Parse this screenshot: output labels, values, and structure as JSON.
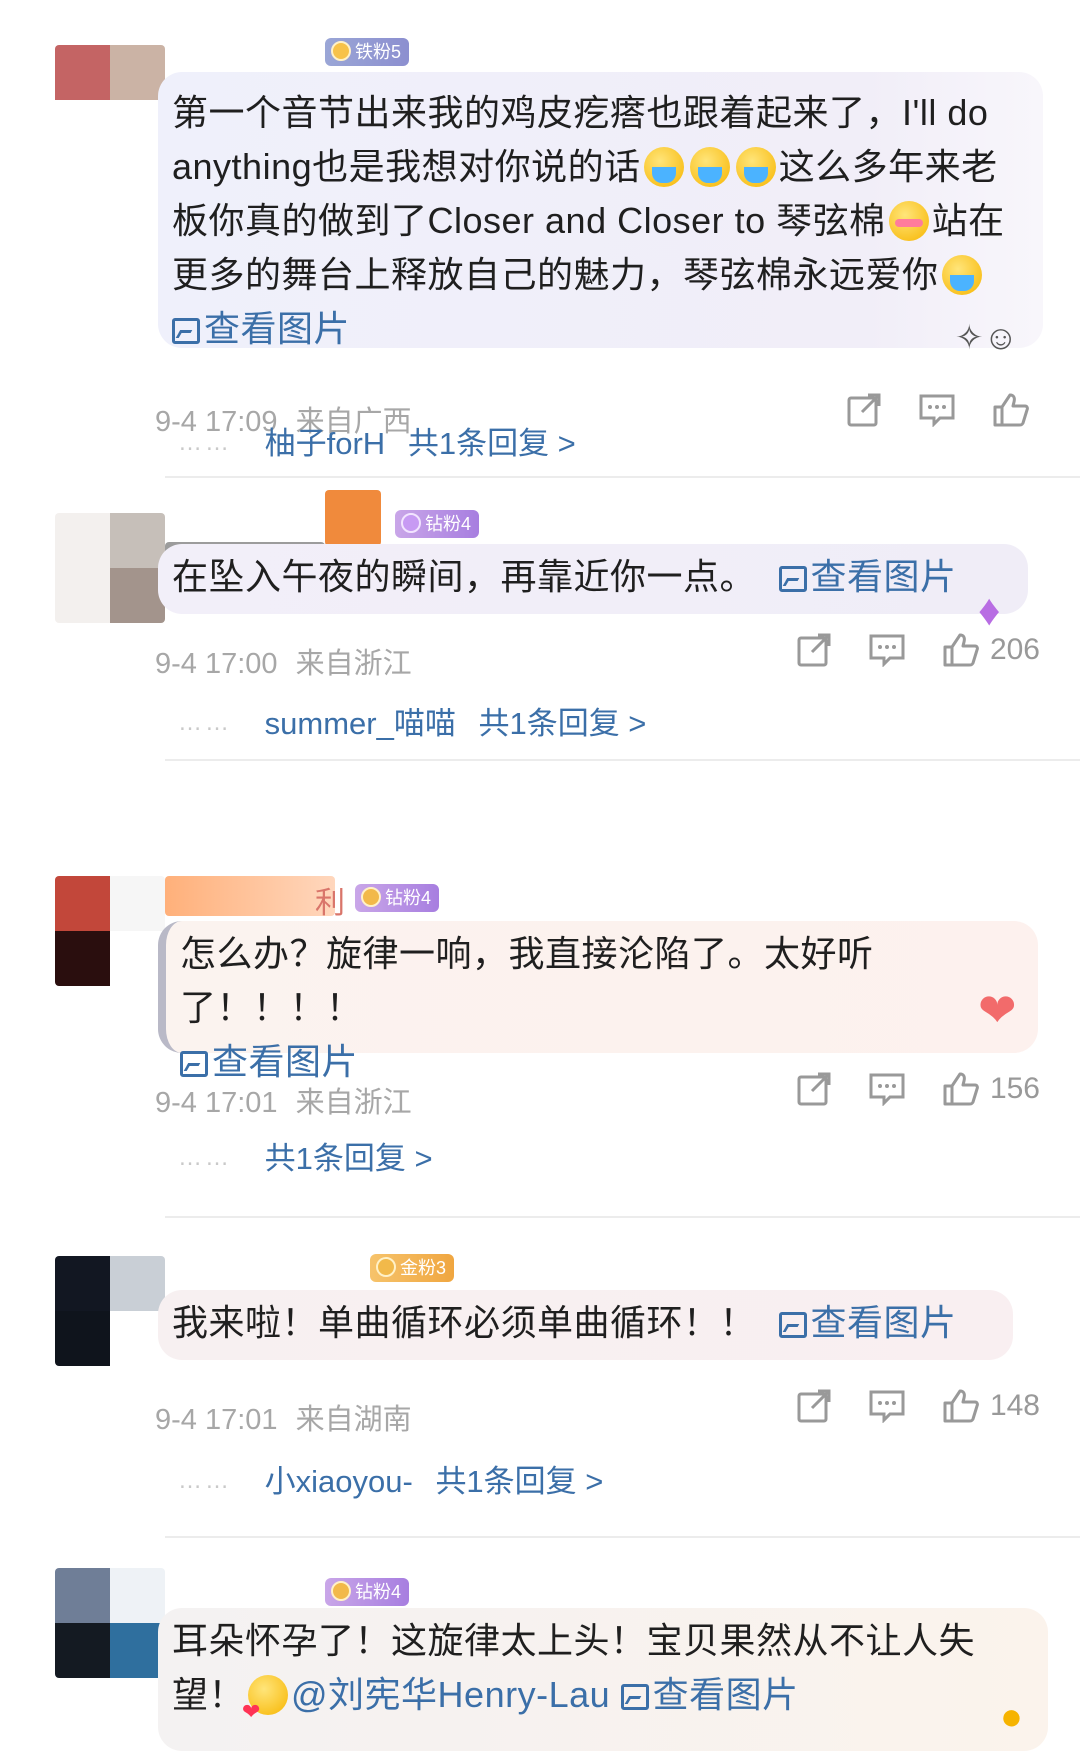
{
  "comments": [
    {
      "badge": "铁粉5",
      "text_parts": [
        "第一个音节出来我的鸡皮疙瘩也跟着起来了，I'll do anything也是我想对你说的话",
        "这么多年来老板你真的做到了Closer and Closer to 琴弦棉",
        "站在更多的舞台上释放自己的魅力，琴弦棉永远爱你"
      ],
      "image_link": "查看图片",
      "time": "9-4 17:09",
      "location": "来自广西",
      "likes": "",
      "reply_user": "柚子forH",
      "reply_count": "共1条回复 >"
    },
    {
      "badge": "钻粉4",
      "text": "在坠入午夜的瞬间，再靠近你一点。",
      "image_link": "查看图片",
      "time": "9-4 17:00",
      "location": "来自浙江",
      "likes": "206",
      "reply_user": "summer_喵喵",
      "reply_count": "共1条回复 >"
    },
    {
      "badge": "钻粉4",
      "name_fragment": "利",
      "text": "怎么办？旋律一响，我直接沦陷了。太好听了！！！！",
      "image_link": "查看图片",
      "time": "9-4 17:01",
      "location": "来自浙江",
      "likes": "156",
      "reply_user": "",
      "reply_count": "共1条回复 >"
    },
    {
      "badge": "金粉3",
      "text": "我来啦！单曲循环必须单曲循环！！",
      "image_link": "查看图片",
      "time": "9-4 17:01",
      "location": "来自湖南",
      "likes": "148",
      "reply_user": "小xiaoyou-",
      "reply_count": "共1条回复 >"
    },
    {
      "badge": "钻粉4",
      "text": "耳朵怀孕了！这旋律太上头！宝贝果然从不让人失望！",
      "mention": "@刘宪华Henry-Lau",
      "image_link": "查看图片"
    }
  ],
  "reply_dots": "……",
  "colors": {
    "link": "#3b6fa8",
    "meta": "#a7a7a7"
  },
  "icons": [
    "share-icon",
    "comment-icon",
    "like-icon",
    "image-icon",
    "crying-emoji",
    "blush-emoji",
    "kiss-emoji"
  ]
}
